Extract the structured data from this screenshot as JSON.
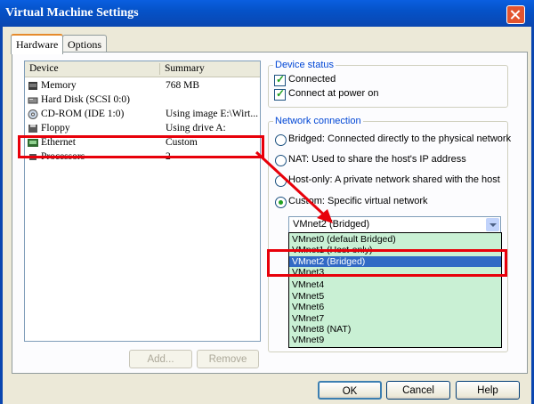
{
  "window": {
    "title": "Virtual Machine Settings"
  },
  "tabs": [
    {
      "label": "Hardware",
      "active": true
    },
    {
      "label": "Options",
      "active": false
    }
  ],
  "device_list": {
    "columns": [
      "Device",
      "Summary"
    ],
    "rows": [
      {
        "name": "Memory",
        "summary": "768 MB",
        "icon": "memory-icon"
      },
      {
        "name": "Hard Disk (SCSI 0:0)",
        "summary": "",
        "icon": "hard-disk-icon"
      },
      {
        "name": "CD-ROM (IDE 1:0)",
        "summary": "Using image E:\\Wirt...",
        "icon": "cdrom-icon"
      },
      {
        "name": "Floppy",
        "summary": "Using drive A:",
        "icon": "floppy-icon"
      },
      {
        "name": "Ethernet",
        "summary": "Custom",
        "icon": "ethernet-icon",
        "selected": true
      },
      {
        "name": "Processors",
        "summary": "2",
        "icon": "processor-icon"
      }
    ]
  },
  "list_buttons": {
    "add": "Add...",
    "remove": "Remove"
  },
  "device_status": {
    "title": "Device status",
    "connected": "Connected",
    "connect_at_power_on": "Connect at power on"
  },
  "network_connection": {
    "title": "Network connection",
    "options": [
      {
        "label": "Bridged: Connected directly to the physical network",
        "checked": false
      },
      {
        "label": "NAT: Used to share the host's IP address",
        "checked": false
      },
      {
        "label": "Host-only: A private network shared with the host",
        "checked": false
      },
      {
        "label": "Custom: Specific virtual network",
        "checked": true
      }
    ],
    "selected_network": "VMnet2 (Bridged)",
    "dropdown_options": [
      "VMnet0 (default Bridged)",
      "VMnet1 (Host-only)",
      "VMnet2 (Bridged)",
      "VMnet3",
      "VMnet4",
      "VMnet5",
      "VMnet6",
      "VMnet7",
      "VMnet8 (NAT)",
      "VMnet9"
    ],
    "highlighted_option_index": 2
  },
  "dialog_buttons": {
    "ok": "OK",
    "cancel": "Cancel",
    "help": "Help"
  },
  "colors": {
    "title_bar": "#0552c8",
    "annotation_red": "#e8000a",
    "dropdown_bg": "#c9f0d4",
    "selection_blue": "#316ac5"
  }
}
